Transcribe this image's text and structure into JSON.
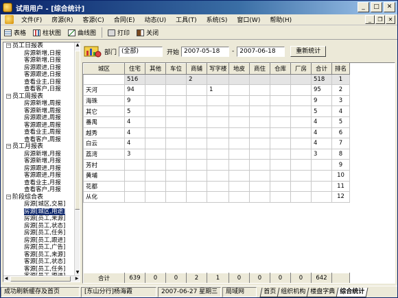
{
  "window": {
    "title": "试用用户 - [综合统计]",
    "btn_min": "_",
    "btn_max": "□",
    "btn_close": "✕"
  },
  "menu": [
    "文件(F)",
    "房源(R)",
    "客源(C)",
    "合同(E)",
    "动态(U)",
    "工具(T)",
    "系统(S)",
    "窗口(W)",
    "帮助(H)"
  ],
  "toolbar": {
    "table": "表格",
    "bar": "柱状图",
    "line": "曲线图",
    "print": "打印",
    "close": "关闭"
  },
  "tree": {
    "groups": [
      {
        "label": "员工日报表",
        "toggle": "−",
        "items": [
          "房源新增,日报",
          "客源新增,日报",
          "房源跟进,日报",
          "客源跟进,日报",
          "查看业主,日报",
          "查看客户,日报"
        ]
      },
      {
        "label": "员工周报表",
        "toggle": "−",
        "items": [
          "房源新增,周报",
          "客源新增,周报",
          "房源跟进,周报",
          "客源跟进,周报",
          "查看业主,周报",
          "查看客户,周报"
        ]
      },
      {
        "label": "员工月报表",
        "toggle": "−",
        "items": [
          "房源新增,月报",
          "客源新增,月报",
          "房源跟进,月报",
          "客源跟进,月报",
          "查看业主,月报",
          "查看客户,月报"
        ]
      },
      {
        "label": "阶段综合表",
        "toggle": "−",
        "items": [
          "房源[城区,交易]",
          "房源[城区,用途]",
          "房源[员工,来源]",
          "房源[员工,状态]",
          "房源[员工,任务]",
          "房源[员工,跟进]",
          "房源[员工,广告]",
          "客源[员工,来源]",
          "客源[员工,状态]",
          "客源[员工,任务]",
          "客源[员工,跟进]",
          "操作[员工,类别]"
        ]
      }
    ],
    "selected": "房源[城区,用途]"
  },
  "filter": {
    "dept_label": "部门",
    "dept_value": "(全部)",
    "start_label": "开始",
    "start_date": "2007-05-18",
    "dash": "-",
    "end_date": "2007-06-18",
    "refresh": "重新统计"
  },
  "table": {
    "headers": [
      "城区",
      "住宅",
      "其他",
      "车位",
      "商铺",
      "写字楼",
      "地皮",
      "商住",
      "仓库",
      "厂房",
      "合计",
      "排名"
    ],
    "rows": [
      [
        "东山",
        "516",
        "",
        "",
        "2",
        "",
        "",
        "",
        "",
        "",
        "518",
        "1"
      ],
      [
        "天河",
        "94",
        "",
        "",
        "",
        "1",
        "",
        "",
        "",
        "",
        "95",
        "2"
      ],
      [
        "海珠",
        "9",
        "",
        "",
        "",
        "",
        "",
        "",
        "",
        "",
        "9",
        "3"
      ],
      [
        "其它",
        "5",
        "",
        "",
        "",
        "",
        "",
        "",
        "",
        "",
        "5",
        "4"
      ],
      [
        "番禺",
        "4",
        "",
        "",
        "",
        "",
        "",
        "",
        "",
        "",
        "4",
        "5"
      ],
      [
        "越秀",
        "4",
        "",
        "",
        "",
        "",
        "",
        "",
        "",
        "",
        "4",
        "6"
      ],
      [
        "白云",
        "4",
        "",
        "",
        "",
        "",
        "",
        "",
        "",
        "",
        "4",
        "7"
      ],
      [
        "荔湾",
        "3",
        "",
        "",
        "",
        "",
        "",
        "",
        "",
        "",
        "3",
        "8"
      ],
      [
        "芳村",
        "",
        "",
        "",
        "",
        "",
        "",
        "",
        "",
        "",
        "",
        "9"
      ],
      [
        "黄埔",
        "",
        "",
        "",
        "",
        "",
        "",
        "",
        "",
        "",
        "",
        "10"
      ],
      [
        "花都",
        "",
        "",
        "",
        "",
        "",
        "",
        "",
        "",
        "",
        "",
        "11"
      ],
      [
        "从化",
        "",
        "",
        "",
        "",
        "",
        "",
        "",
        "",
        "",
        "",
        "12"
      ]
    ],
    "totals": [
      "合计",
      "639",
      "0",
      "0",
      "2",
      "1",
      "0",
      "0",
      "0",
      "0",
      "642",
      ""
    ]
  },
  "status": {
    "message": "成功刷新缓存及首页",
    "user": "[东山分行]杨海霞",
    "date": "2007-06-27 星期三",
    "network": "局域网",
    "tabs": [
      "首页",
      "组织机构",
      "楼盘字典",
      "综合统计"
    ],
    "active_tab": "综合统计"
  }
}
